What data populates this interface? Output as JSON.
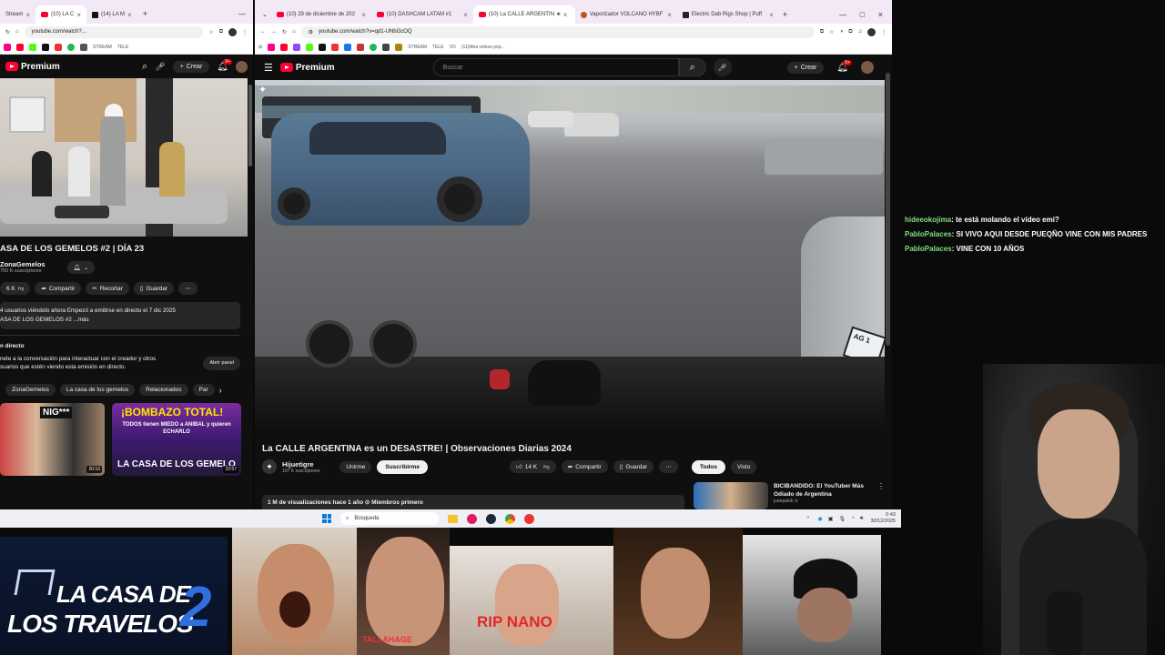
{
  "left_window": {
    "tabs": [
      {
        "label": "Stream"
      },
      {
        "label": "(10) LA C"
      },
      {
        "label": "(14) LA M"
      }
    ],
    "url": "youtube.com/watch?...",
    "bookmarks": [
      "STREAM",
      "TELE"
    ],
    "premium_label": "Premium",
    "create_label": "Crear",
    "notif_count": "9+",
    "video_title": "ASA DE LOS GEMELOS #2 | DÍA 23",
    "channel_name": "ZonaGemelos",
    "subscribers": "750 K suscriptores",
    "likes": "6 K",
    "share_label": "Compartir",
    "clip_label": "Recortar",
    "save_label": "Guardar",
    "desc_line1": "4 usuarios viéndolo ahora  Empezó a emitirse en directo el 7 dic 2025",
    "desc_line2": "ASA DE LOS GEMELOS #2 ...más",
    "chat_heading": "n directo",
    "chat_text_1": "nete a la conversación para interactuar con el creador y otros",
    "chat_text_2": "suarios que estén viendo esta emisión en directo.",
    "open_panel_label": "Abrir panel",
    "chips": [
      "ZonaGemelos",
      "La casa de los gemelos",
      "Relacionados",
      "Par"
    ],
    "rec_thumbs": [
      {
        "text": "NIG***",
        "duration": "20:10"
      },
      {
        "text": "¡BOMBAZO TOTAL!",
        "sub": "TODOS tienen MIEDO a ANIBAL y quieren ECHARLO",
        "footer": "LA CASA DE LOS GEMELO",
        "duration": "33:57"
      }
    ]
  },
  "main_window": {
    "tabs": [
      {
        "label": "(10) 29 de diciembre de 202"
      },
      {
        "label": "(10) DASHCAM LATAM #1"
      },
      {
        "label": "(10) La CALLE ARGENTIN"
      },
      {
        "label": "Vaporizador VOLCANO HYBF"
      },
      {
        "label": "Electric Dab Rigs Shop | Puff"
      }
    ],
    "url": "youtube.com/watch?v=qd1-UNbGcOQ",
    "bookmarks": [
      "STREAM",
      "TELE",
      "VO",
      "(11)Mea videos pop..."
    ],
    "premium_label": "Premium",
    "search_placeholder": "Buscar",
    "create_label": "Crear",
    "notif_count": "9+",
    "video_title": "La CALLE ARGENTINA es un DESASTRE! | Observaciones Diarias 2024",
    "channel_name": "Hijuetigre",
    "subscribers": "107 K suscriptores",
    "join_label": "Unirme",
    "subscribe_label": "Suscribirme",
    "likes": "14 K",
    "share_label": "Compartir",
    "save_label": "Guardar",
    "meta": "1 M de visualizaciones  hace 1 año  ⊙ Miembros primero",
    "filter_all": "Todos",
    "filter_seen": "Visto",
    "sidebar_video_title": "BICIBANDIDO: El YouTuber Más Odiado de Argentina",
    "sidebar_channel": "juanpaiok ⊙"
  },
  "taskbar": {
    "search_placeholder": "Búsqueda",
    "time": "0:43",
    "date": "30/12/2025"
  },
  "chat": [
    {
      "user": "hideeokojima",
      "text": ": te está molando el vídeo emi?"
    },
    {
      "user": "PabloPalaces",
      "text": ": SI VIVO AQUI DESDE PUEQÑO VINE CON MIS PADRES"
    },
    {
      "user": "PabloPalaces",
      "text": ": VINE CON 10 AÑOS"
    }
  ],
  "overlay": {
    "logo_line1": "LA CASA DE",
    "logo_line2": "LOS TRAVELOS",
    "logo_number": "2",
    "face2_caption": "TALLAHAGE",
    "face4_caption": "RIP NANO"
  },
  "colors": {
    "yt_red": "#ff0033",
    "chat_user": "#7ee07e",
    "taskbar_bg": "#eef0f6",
    "tabbar_bg": "#f3e8f6"
  }
}
